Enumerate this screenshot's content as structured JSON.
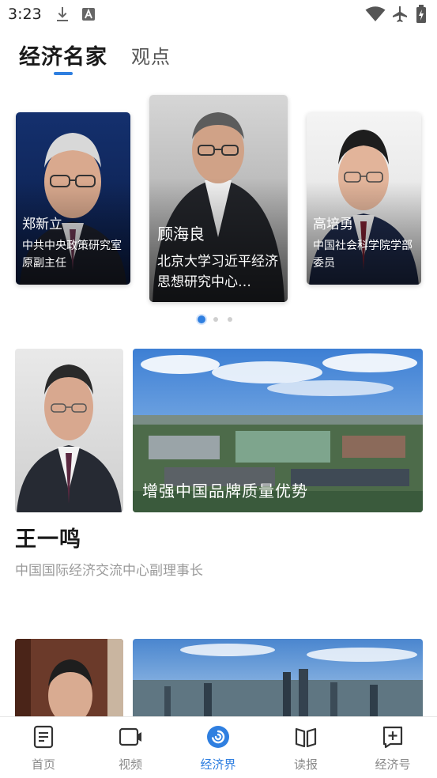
{
  "status_bar": {
    "time": "3:23",
    "icons": [
      "download-icon",
      "text-a-icon",
      "wifi-icon",
      "airplane-icon",
      "battery-icon"
    ]
  },
  "tabs": [
    {
      "label": "经济名家",
      "active": true
    },
    {
      "label": "观点",
      "active": false
    }
  ],
  "carousel": {
    "cards": [
      {
        "name": "郑新立",
        "title": "中共中央政策研究室原副主任"
      },
      {
        "name": "顾海良",
        "title": "北京大学习近平经济思想研究中心…"
      },
      {
        "name": "高培勇",
        "title": "中国社会科学院学部委员"
      }
    ],
    "active_index": 0,
    "page_count": 3
  },
  "features": [
    {
      "person_name": "王一鸣",
      "person_title": "中国国际经济交流中心副理事长",
      "photo_caption": "增强中国品牌质量优势"
    },
    {
      "person_name": "",
      "person_title": "",
      "photo_caption": ""
    }
  ],
  "bottom_nav": [
    {
      "label": "首页",
      "icon": "document-icon",
      "active": false
    },
    {
      "label": "视频",
      "icon": "video-icon",
      "active": false
    },
    {
      "label": "经济界",
      "icon": "spiral-icon",
      "active": true
    },
    {
      "label": "读报",
      "icon": "book-icon",
      "active": false
    },
    {
      "label": "经济号",
      "icon": "add-post-icon",
      "active": false
    }
  ],
  "colors": {
    "accent": "#2f7fe0",
    "text_primary": "#1a1a1a",
    "text_secondary": "#9a9a9a",
    "nav_inactive": "#8a8a8a"
  }
}
